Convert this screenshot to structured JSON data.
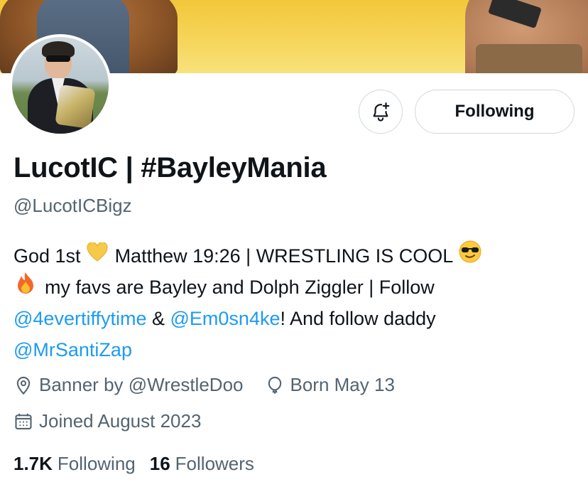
{
  "profile": {
    "display_name": "LucotIC | #BayleyMania",
    "handle": "@LucotICBigz",
    "follow_button_label": "Following",
    "notify_icon": "bell-plus-icon"
  },
  "bio": {
    "line1": {
      "t1": "God 1st",
      "emoji1": "yellow-heart-icon",
      "t2": "Matthew 19:26 | WRESTLING IS COOL",
      "emoji2": "sunglasses-face-icon"
    },
    "line2": {
      "emoji": "fire-icon",
      "t1": "my favs are Bayley and Dolph Ziggler | Follow"
    },
    "line3": {
      "mention1": "@4evertiffytime",
      "t1": " & ",
      "mention2": "@Em0sn4ke",
      "t2": "! And follow daddy"
    },
    "line4": {
      "mention1": "@MrSantiZap"
    }
  },
  "meta": {
    "location_icon": "location-pin-icon",
    "location_text": "Banner by @WrestleDoo",
    "birthday_icon": "balloon-icon",
    "birthday_text": "Born May 13",
    "joined_icon": "calendar-icon",
    "joined_text": "Joined August 2023"
  },
  "stats": {
    "following_count": "1.7K",
    "following_label": "Following",
    "followers_count": "16",
    "followers_label": "Followers"
  },
  "colors": {
    "link": "#1d9bf0",
    "secondary_text": "#536471",
    "primary_text": "#0f1419",
    "border": "#cfd9de"
  }
}
